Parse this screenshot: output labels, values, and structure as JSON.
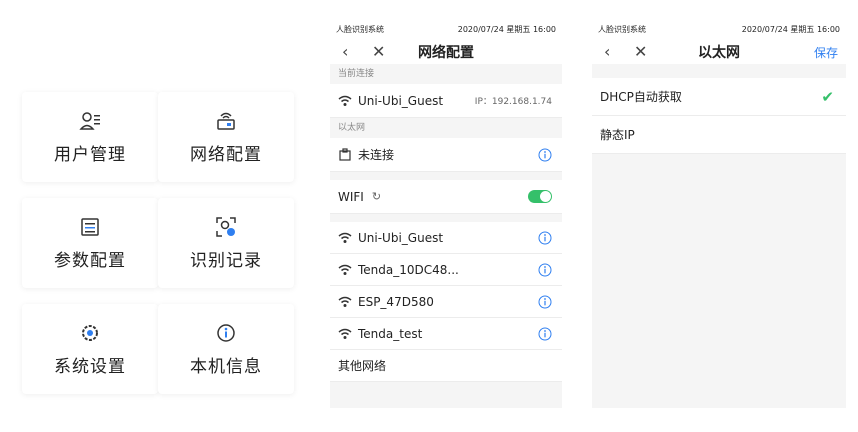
{
  "menu": {
    "items": [
      {
        "label": "用户管理",
        "icon": "user-manage-icon"
      },
      {
        "label": "网络配置",
        "icon": "router-icon"
      },
      {
        "label": "参数配置",
        "icon": "settings-doc-icon"
      },
      {
        "label": "识别记录",
        "icon": "face-scan-icon"
      },
      {
        "label": "系统设置",
        "icon": "gear-icon"
      },
      {
        "label": "本机信息",
        "icon": "info-icon"
      }
    ]
  },
  "network_screen": {
    "status_left": "人脸识别系统",
    "status_right": "2020/07/24 星期五 16:00",
    "title": "网络配置",
    "section_current": "当前连接",
    "current_ssid": "Uni-Ubi_Guest",
    "current_ip": "IP：192.168.1.74",
    "section_ethernet": "以太网",
    "ethernet_status": "未连接",
    "wifi_label": "WIFI",
    "wifi_on": true,
    "networks": [
      "Uni-Ubi_Guest",
      "Tenda_10DC48...",
      "ESP_47D580",
      "Tenda_test"
    ],
    "other_networks": "其他网络"
  },
  "ethernet_screen": {
    "status_left": "人脸识别系统",
    "status_right": "2020/07/24 星期五 16:00",
    "title": "以太网",
    "save_label": "保存",
    "option_dhcp": "DHCP自动获取",
    "option_static": "静态IP",
    "selected": "DHCP自动获取"
  },
  "colors": {
    "accent": "#2f7ff0",
    "toggle_on": "#35c06a"
  }
}
